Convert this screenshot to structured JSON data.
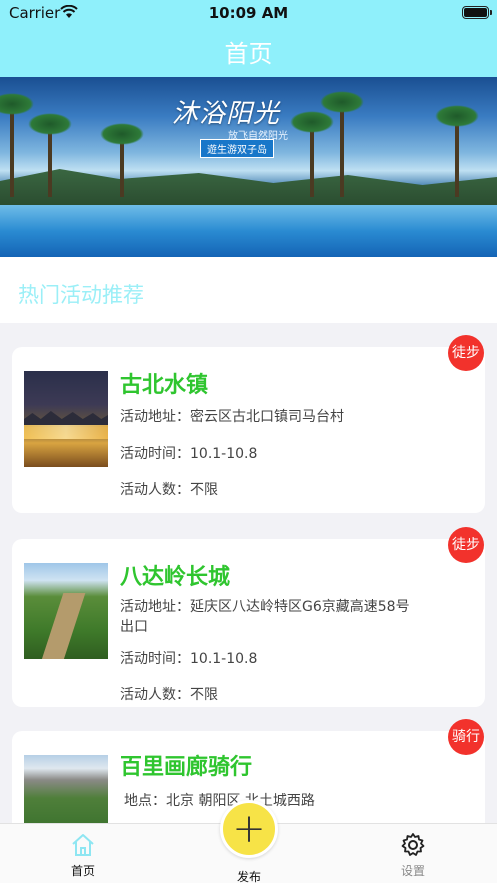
{
  "status_bar": {
    "carrier": "Carrier",
    "time": "10:09 AM"
  },
  "nav": {
    "title": "首页"
  },
  "banner": {
    "title": "沐浴阳光",
    "subtitle": "放飞自然阳光",
    "tag": "遊生游双子岛"
  },
  "section": {
    "title": "热门活动推荐"
  },
  "activities": [
    {
      "name": "古北水镇",
      "badge": "徒步",
      "address": "活动地址：密云区古北口镇司马台村",
      "time": "活动时间：10.1-10.8",
      "people": "活动人数：不限"
    },
    {
      "name": "八达岭长城",
      "badge": "徒步",
      "address_line1": "活动地址：延庆区八达岭特区G6京藏高速58号",
      "address_line2": "出口",
      "time": "活动时间：10.1-10.8",
      "people": "活动人数：不限"
    },
    {
      "name": "百里画廊骑行",
      "badge": "骑行",
      "address": "地点：北京  朝阳区  北土城西路"
    }
  ],
  "tabs": {
    "home": "首页",
    "publish": "发布",
    "settings": "设置"
  },
  "colors": {
    "nav_bg": "#8ff0fb",
    "accent_green": "#2fc52f",
    "badge_red": "#f2322c",
    "publish_yellow": "#f7e347"
  }
}
